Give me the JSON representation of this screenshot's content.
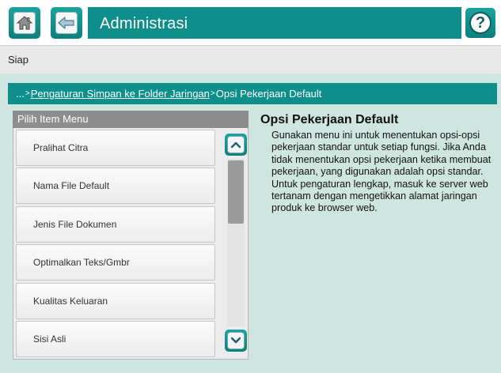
{
  "header": {
    "title": "Administrasi",
    "home_icon": "home-icon",
    "back_icon": "back-arrow-icon",
    "help_icon": "help-question-icon",
    "help_symbol": "?"
  },
  "status": {
    "text": "Siap"
  },
  "breadcrumb": {
    "prefix": "...",
    "link": "Pengaturan Simpan ke Folder Jaringan",
    "current": "Opsi Pekerjaan Default",
    "separator": ">"
  },
  "menu": {
    "header": "Pilih Item Menu",
    "items": [
      {
        "label": "Pralihat Citra"
      },
      {
        "label": "Nama File Default"
      },
      {
        "label": "Jenis File Dokumen"
      },
      {
        "label": "Optimalkan Teks/Gmbr"
      },
      {
        "label": "Kualitas Keluaran"
      },
      {
        "label": "Sisi Asli"
      }
    ]
  },
  "description": {
    "title": "Opsi Pekerjaan Default",
    "body": "Gunakan menu ini untuk menentukan opsi-opsi pekerjaan standar untuk setiap fungsi. Jika Anda tidak menentukan opsi pekerjaan ketika membuat pekerjaan, yang digunakan adalah opsi standar. Untuk pengaturan lengkap, masuk ke server web tertanam dengan mengetikkan alamat jaringan produk ke browser web."
  },
  "colors": {
    "accent": "#0f8f8c",
    "content_bg": "#cfe6e0",
    "status_bg": "#e9e9e9",
    "menu_header_bg": "#8d8d8d"
  }
}
